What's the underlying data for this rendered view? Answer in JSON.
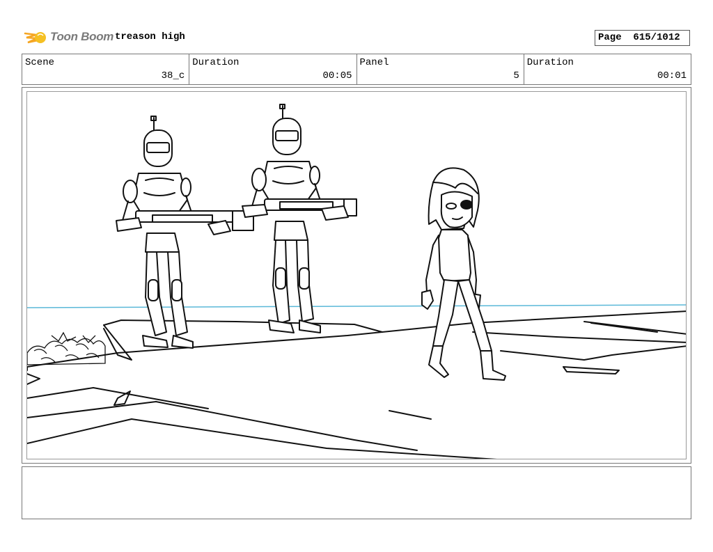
{
  "header": {
    "logo_text": "Toon Boom",
    "project_title": "treason high",
    "page_label": "Page",
    "page_number": "615/1012"
  },
  "info": {
    "scene_label": "Scene",
    "scene_value": "38_c",
    "scene_duration_label": "Duration",
    "scene_duration_value": "00:05",
    "panel_label": "Panel",
    "panel_value": "5",
    "panel_duration_label": "Duration",
    "panel_duration_value": "00:01"
  },
  "colors": {
    "horizon_line": "#5ab8d8",
    "logo_orange": "#f5a623",
    "logo_gray": "#7a7a7a"
  },
  "notes": {
    "text": ""
  }
}
